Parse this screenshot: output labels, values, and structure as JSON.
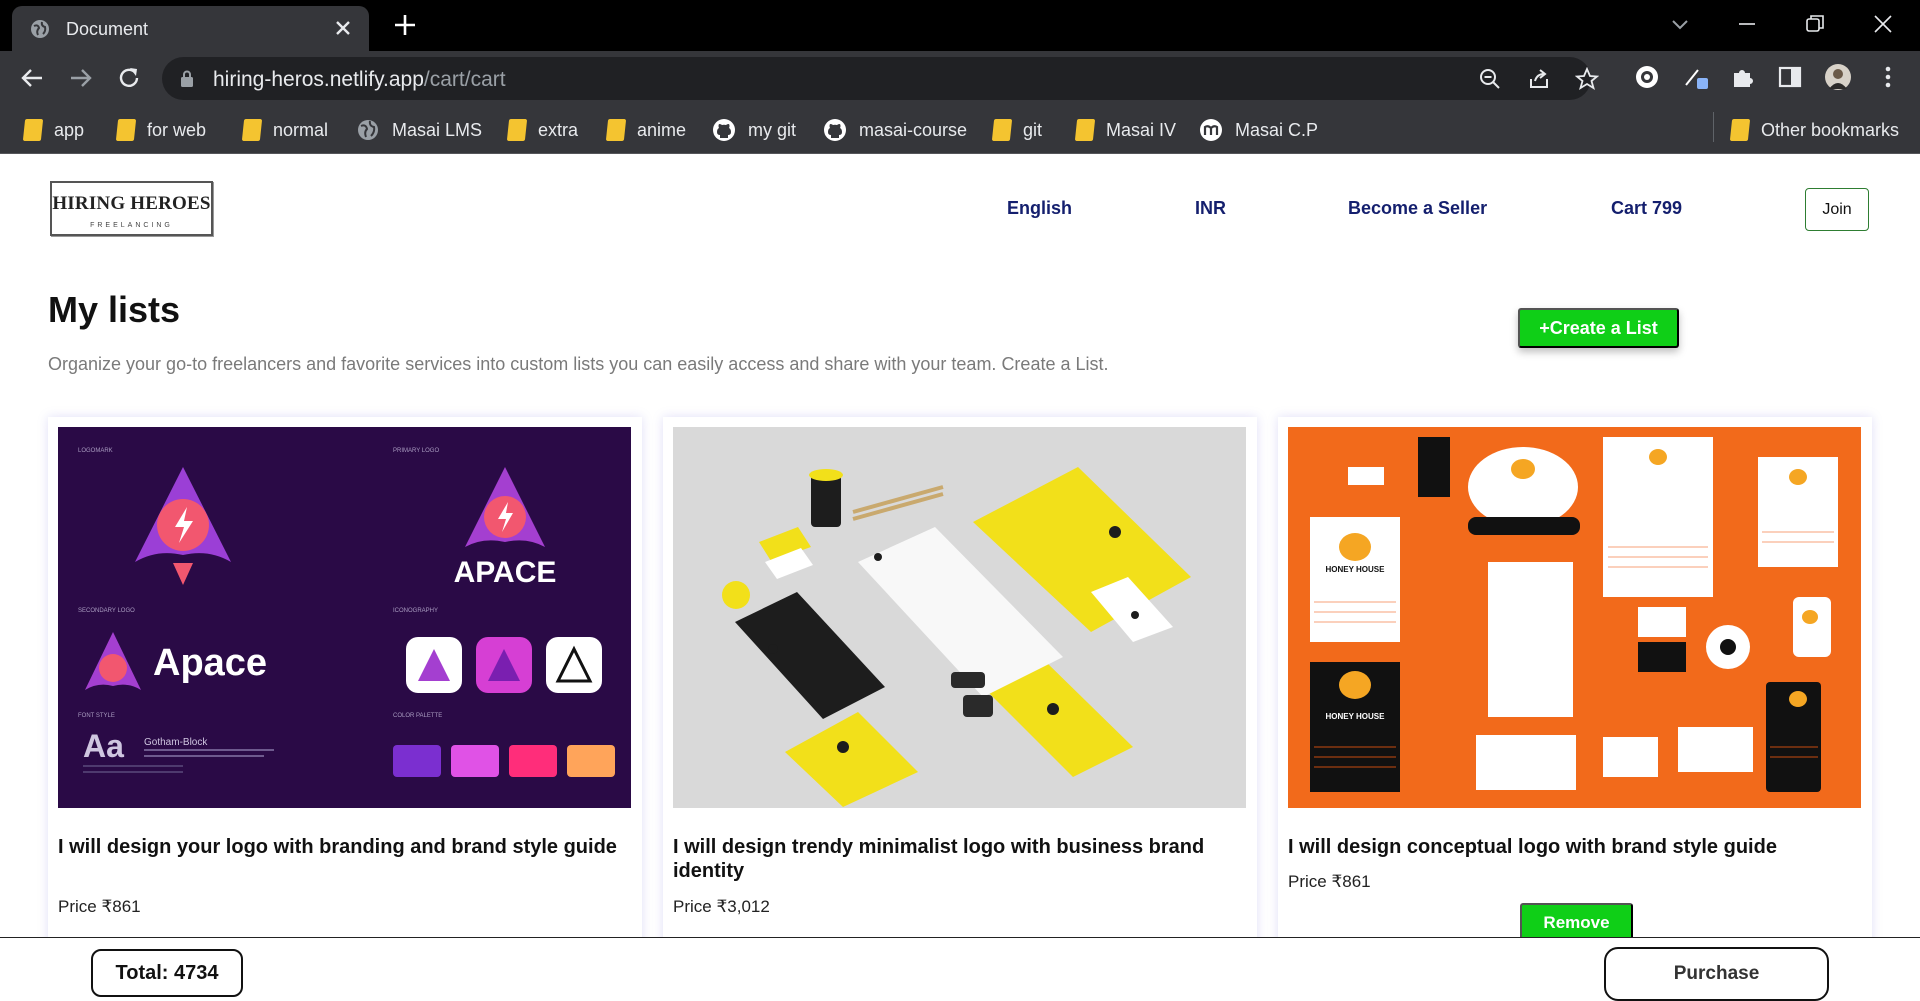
{
  "browser": {
    "tab_title": "Document",
    "url_host": "hiring-heros.netlify.app",
    "url_path": "/cart/cart",
    "bookmarks": [
      {
        "label": "app",
        "icon": "folder-icon"
      },
      {
        "label": "for web",
        "icon": "folder-icon"
      },
      {
        "label": "normal",
        "icon": "folder-icon"
      },
      {
        "label": "Masai LMS",
        "icon": "globe-icon"
      },
      {
        "label": "extra",
        "icon": "folder-icon"
      },
      {
        "label": "anime",
        "icon": "folder-icon"
      },
      {
        "label": "my git",
        "icon": "github-icon"
      },
      {
        "label": "masai-course",
        "icon": "github-icon"
      },
      {
        "label": "git",
        "icon": "folder-icon"
      },
      {
        "label": "Masai IV",
        "icon": "folder-icon"
      },
      {
        "label": "Masai C.P",
        "icon": "m-icon"
      }
    ],
    "other_bookmarks": "Other bookmarks"
  },
  "header": {
    "logo_main": "HIRING HEROES",
    "logo_sub": "FREELANCING",
    "nav": {
      "language": "English",
      "currency": "INR",
      "seller": "Become a Seller",
      "cart": "Cart 799"
    },
    "join": "Join"
  },
  "main": {
    "title": "My lists",
    "create_button": "+Create a List",
    "description": "Organize your go-to freelancers and favorite services into custom lists you can easily access and share with your team. Create a List.",
    "cards": [
      {
        "title": "I will design your logo with branding and brand style guide",
        "price": "Price ₹861",
        "image": {
          "bg": "#2a0a46",
          "wordmark_caps": "APACE",
          "wordmark": "Apace",
          "font_sample": "Aa",
          "font_name": "Gotham-Block",
          "section_labels": [
            "LOGOMARK",
            "PRIMARY LOGO",
            "SECONDARY LOGO",
            "ICONOGRAPHY",
            "FONT STYLE",
            "COLOR PALETTE"
          ]
        }
      },
      {
        "title": "I will design trendy minimalist logo with business brand identity",
        "price": "Price ₹3,012",
        "image": {
          "bg": "#d9d9d9",
          "accent": "#f2e01a"
        }
      },
      {
        "title": "I will design conceptual logo with brand style guide",
        "price": "Price ₹861",
        "button": "Remove",
        "image": {
          "bg": "#f26a1b",
          "brand": "HONEY HOUSE"
        }
      }
    ]
  },
  "footer": {
    "total": "Total: 4734",
    "purchase": "Purchase"
  }
}
